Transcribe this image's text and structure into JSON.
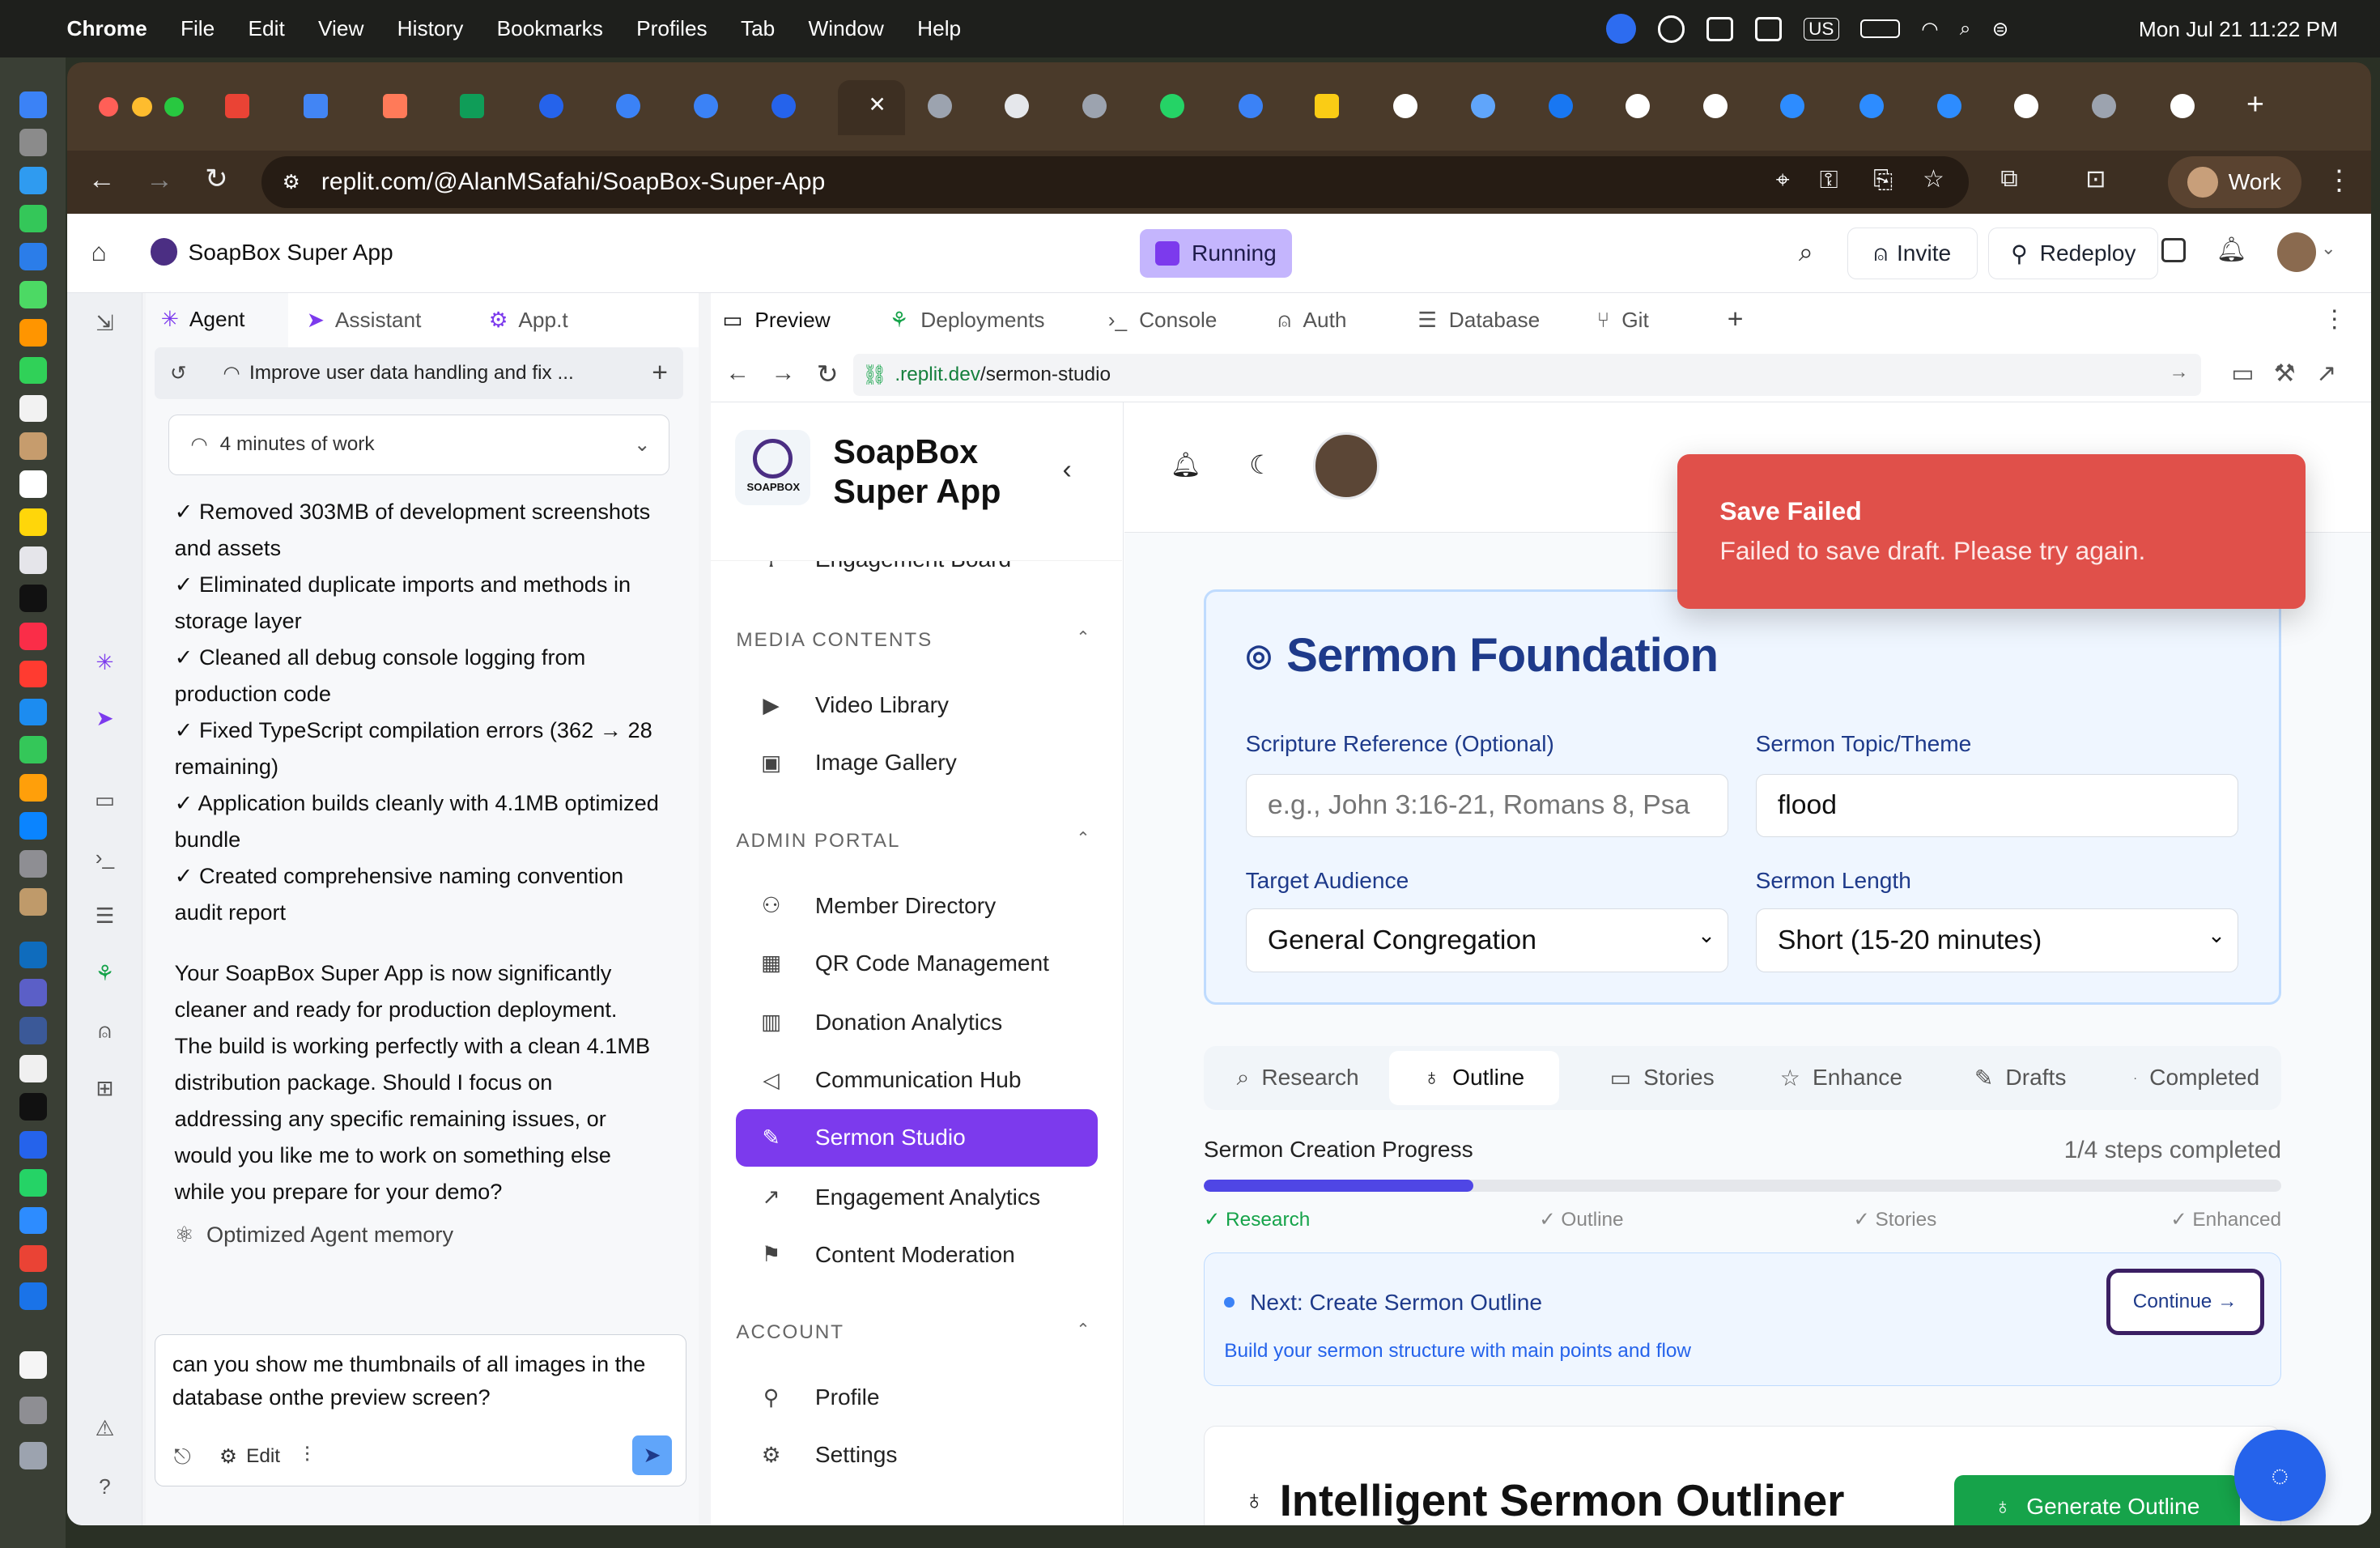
{
  "menubar": {
    "app": "Chrome",
    "items": [
      "File",
      "Edit",
      "View",
      "History",
      "Bookmarks",
      "Profiles",
      "Tab",
      "Window",
      "Help"
    ],
    "clock": "Mon Jul 21  11:22 PM",
    "keyboard": "US"
  },
  "browser": {
    "url": "replit.com/@AlanMSafahi/SoapBox-Super-App",
    "profile": "Work"
  },
  "replit": {
    "project_title": "SoapBox Super App",
    "status": "Running",
    "invite": "Invite",
    "redeploy": "Redeploy"
  },
  "agent": {
    "tabs": [
      "Agent",
      "Assistant",
      "App.t"
    ],
    "thread_title": "Improve user data handling and fix ...",
    "work_summary": "4 minutes of work",
    "checklist": [
      "✓ Removed 303MB of development screenshots and assets",
      "✓ Eliminated duplicate imports and methods in storage layer",
      "✓ Cleaned all debug console logging from production code",
      "✓ Fixed TypeScript compilation errors (362 → 28 remaining)",
      "✓ Application builds cleanly with 4.1MB optimized bundle",
      "✓ Created comprehensive naming convention audit report"
    ],
    "message": "Your SoapBox Super App is now significantly cleaner and ready for production deployment. The build is working perfectly with a clean 4.1MB distribution package. Should I focus on addressing any specific remaining issues, or would you like me to work on something else while you prepare for your demo?",
    "memory_note": "Optimized Agent memory",
    "input_text": "can you show me thumbnails of all images in the database onthe preview screen?",
    "edit_label": "Edit"
  },
  "preview": {
    "tabs": [
      "Preview",
      "Deployments",
      "Console",
      "Auth",
      "Database",
      "Git"
    ],
    "url_prefix": ".replit.dev",
    "url_path": "/sermon-studio"
  },
  "site": {
    "brand_line1": "SoapBox",
    "brand_line2": "Super App",
    "logo_text": "SOAPBOX",
    "partial_item": "Engagement Board",
    "sections": {
      "media": "MEDIA CONTENTS",
      "admin": "ADMIN PORTAL",
      "account": "ACCOUNT"
    },
    "media_items": [
      "Video Library",
      "Image Gallery"
    ],
    "admin_items": [
      "Member Directory",
      "QR Code Management",
      "Donation Analytics",
      "Communication Hub",
      "Sermon Studio",
      "Engagement Analytics",
      "Content Moderation"
    ],
    "account_items": [
      "Profile",
      "Settings"
    ],
    "active_item": "Sermon Studio"
  },
  "toast": {
    "title": "Save Failed",
    "message": "Failed to save draft. Please try again."
  },
  "sermon": {
    "title": "Sermon Foundation",
    "scripture_label": "Scripture Reference (Optional)",
    "scripture_placeholder": "e.g., John 3:16-21, Romans 8, Psa",
    "topic_label": "Sermon Topic/Theme",
    "topic_value": "flood",
    "audience_label": "Target Audience",
    "audience_value": "General Congregation",
    "length_label": "Sermon Length",
    "length_value": "Short (15-20 minutes)",
    "steps": [
      "Research",
      "Outline",
      "Stories",
      "Enhance",
      "Drafts",
      "Completed"
    ],
    "active_step": "Outline",
    "progress_label": "Sermon Creation Progress",
    "progress_text": "1/4 steps completed",
    "progress_fraction": 0.25,
    "progress_marks": [
      "✓ Research",
      "✓ Outline",
      "✓ Stories",
      "✓ Enhanced"
    ],
    "next_title": "Next: Create Sermon Outline",
    "next_desc": "Build your sermon structure with main points and flow",
    "continue": "Continue →",
    "outliner_title": "Intelligent Sermon Outliner",
    "generate": "Generate Outline"
  },
  "colors": {
    "accent": "#7c3aed",
    "toast": "#e0504a",
    "progress": "#4f46e5",
    "green": "#16a34a"
  }
}
